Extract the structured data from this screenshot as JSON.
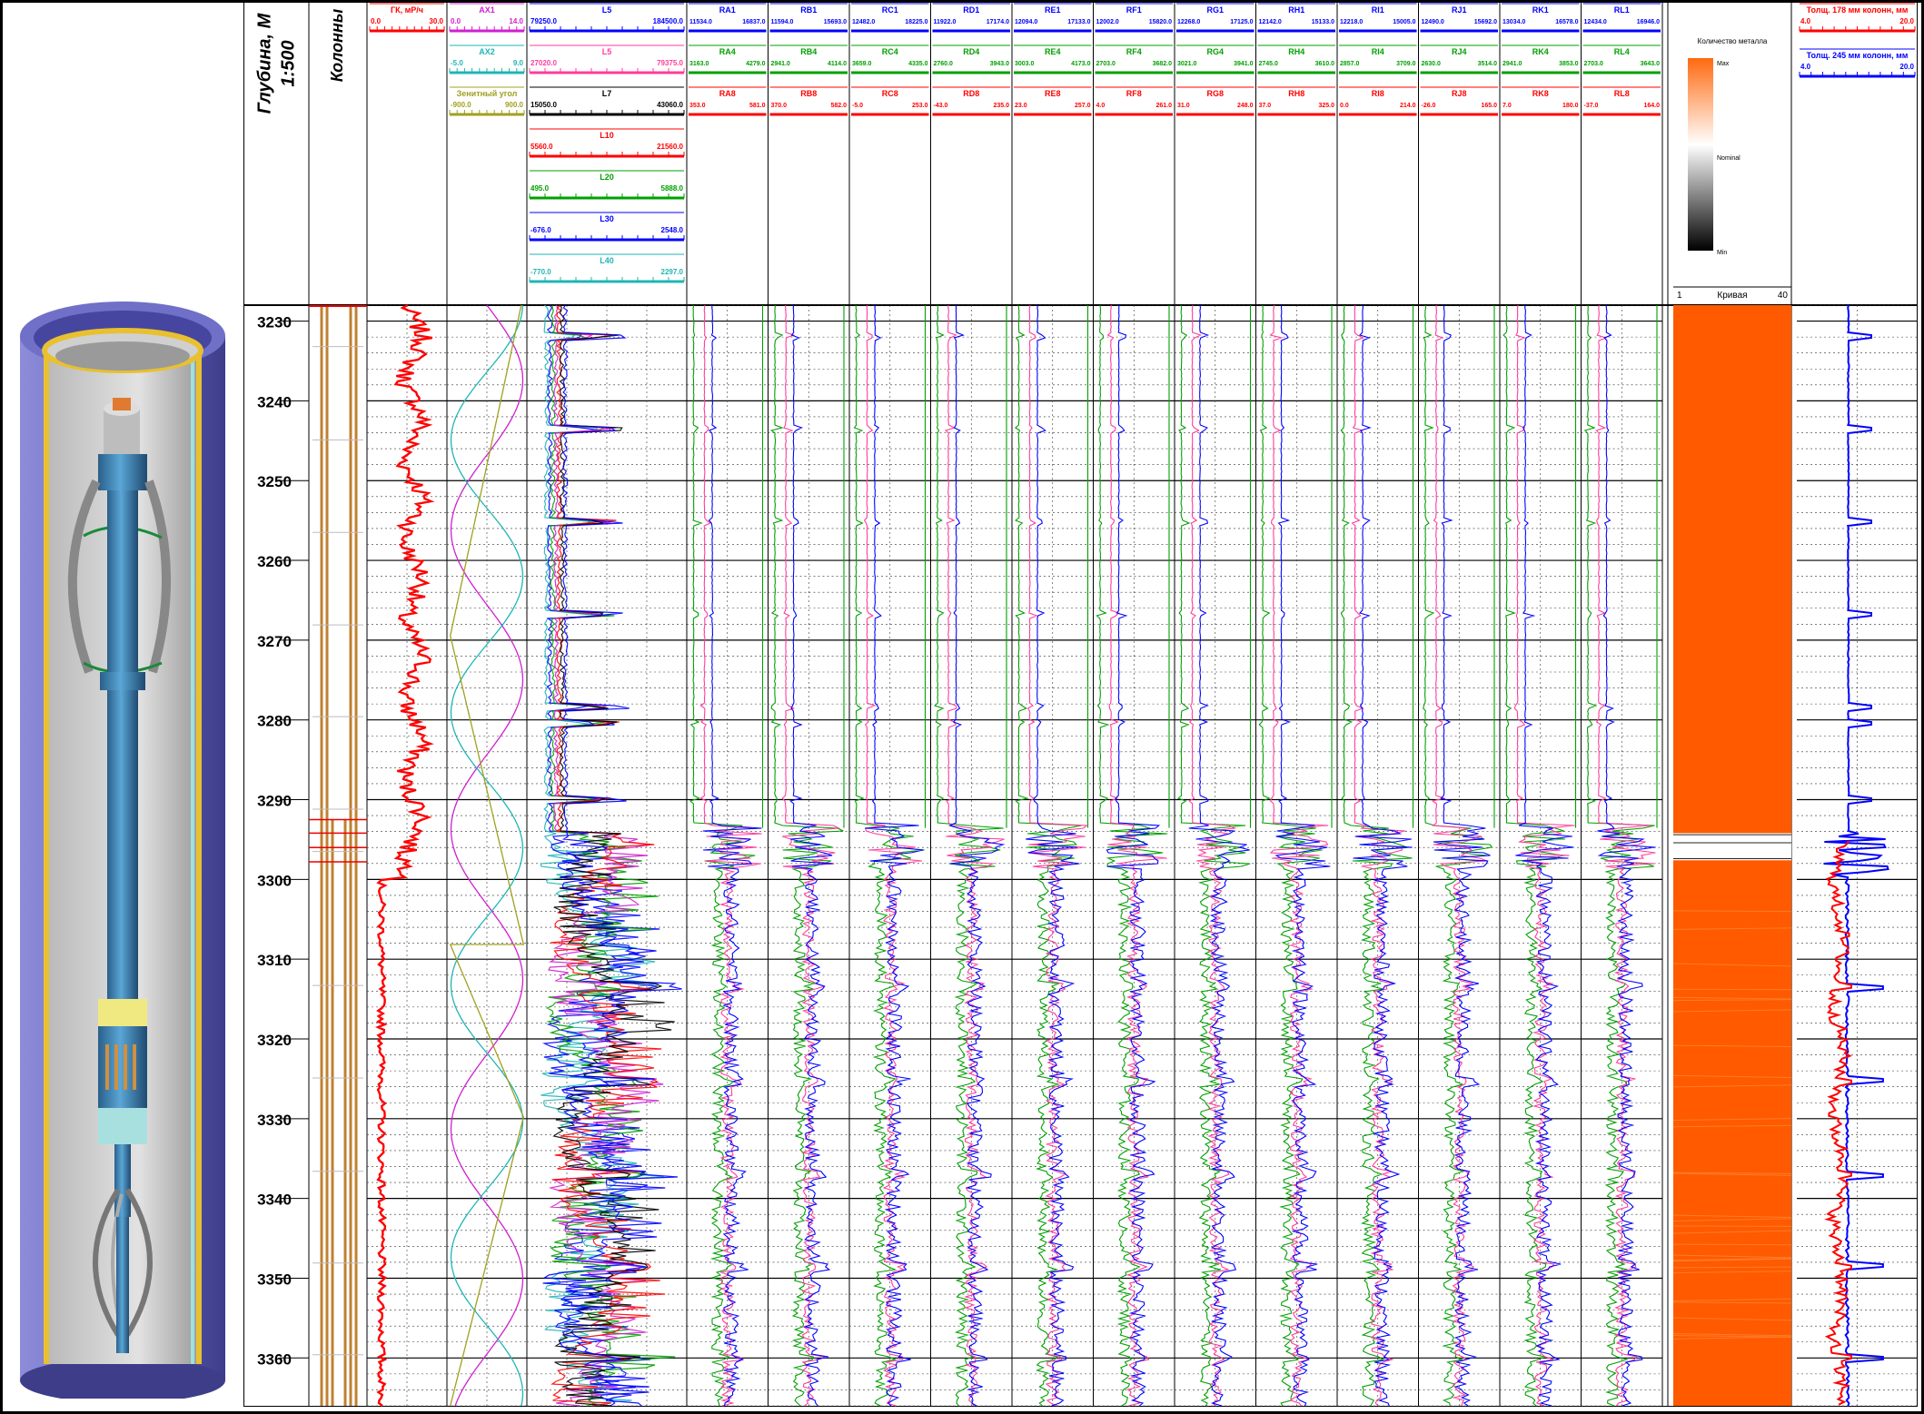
{
  "header": {
    "depth_title": "Глубина, М",
    "scale": "1:500",
    "columns_title": "Колонны"
  },
  "colors": {
    "red": "#ff0000",
    "pink": "#ff3c9b",
    "green": "#00a000",
    "blue": "#0000ff",
    "teal": "#1fb5b5",
    "olive": "#a0a020",
    "magenta": "#d020d0",
    "black": "#000000",
    "orange": "#ff5a00",
    "casing": "#c08030"
  },
  "tracks": {
    "gk": {
      "name": "ГК, мР/ч",
      "min": "0.0",
      "max": "30.0",
      "color": "red"
    },
    "angles": [
      {
        "name": "AX1",
        "min": "0.0",
        "max": "14.0",
        "color": "magenta"
      },
      {
        "name": "AX2",
        "min": "-5.0",
        "max": "9.0",
        "color": "teal"
      },
      {
        "name": "Зенитный угол",
        "min": "-900.0",
        "max": "900.0",
        "color": "olive"
      }
    ],
    "long": [
      {
        "name": "L5",
        "min": "79250.0",
        "max": "184500.0",
        "color": "blue"
      },
      {
        "name": "L5",
        "min": "27020.0",
        "max": "79375.0",
        "color": "pink"
      },
      {
        "name": "L7",
        "min": "15050.0",
        "max": "43060.0",
        "color": "black"
      },
      {
        "name": "L10",
        "min": "5560.0",
        "max": "21560.0",
        "color": "red"
      },
      {
        "name": "L20",
        "min": "495.0",
        "max": "5888.0",
        "color": "green"
      },
      {
        "name": "L30",
        "min": "-676.0",
        "max": "2548.0",
        "color": "blue"
      },
      {
        "name": "L40",
        "min": "-770.0",
        "max": "2297.0",
        "color": "teal"
      }
    ],
    "sensors": [
      {
        "h": [
          [
            "RA1",
            "11534.0",
            "16837.0"
          ],
          [
            "RA4",
            "3163.0",
            "4279.0"
          ],
          [
            "RA8",
            "353.0",
            "581.0"
          ]
        ]
      },
      {
        "h": [
          [
            "RB1",
            "11594.0",
            "15693.0"
          ],
          [
            "RB4",
            "2941.0",
            "4114.0"
          ],
          [
            "RB8",
            "370.0",
            "582.0"
          ]
        ]
      },
      {
        "h": [
          [
            "RC1",
            "12482.0",
            "18225.0"
          ],
          [
            "RC4",
            "3659.0",
            "4335.0"
          ],
          [
            "RC8",
            "-5.0",
            "253.0"
          ]
        ]
      },
      {
        "h": [
          [
            "RD1",
            "11922.0",
            "17174.0"
          ],
          [
            "RD4",
            "2760.0",
            "3943.0"
          ],
          [
            "RD8",
            "-43.0",
            "235.0"
          ]
        ]
      },
      {
        "h": [
          [
            "RE1",
            "12094.0",
            "17133.0"
          ],
          [
            "RE4",
            "3003.0",
            "4173.0"
          ],
          [
            "RE8",
            "23.0",
            "257.0"
          ]
        ]
      },
      {
        "h": [
          [
            "RF1",
            "12002.0",
            "15820.0"
          ],
          [
            "RF4",
            "2703.0",
            "3682.0"
          ],
          [
            "RF8",
            "4.0",
            "261.0"
          ]
        ]
      },
      {
        "h": [
          [
            "RG1",
            "12268.0",
            "17125.0"
          ],
          [
            "RG4",
            "3021.0",
            "3941.0"
          ],
          [
            "RG8",
            "31.0",
            "248.0"
          ]
        ]
      },
      {
        "h": [
          [
            "RH1",
            "12142.0",
            "15133.0"
          ],
          [
            "RH4",
            "2745.0",
            "3610.0"
          ],
          [
            "RH8",
            "37.0",
            "325.0"
          ]
        ]
      },
      {
        "h": [
          [
            "RI1",
            "12218.0",
            "15005.0"
          ],
          [
            "RI4",
            "2857.0",
            "3709.0"
          ],
          [
            "RI8",
            "0.0",
            "214.0"
          ]
        ]
      },
      {
        "h": [
          [
            "RJ1",
            "12490.0",
            "15692.0"
          ],
          [
            "RJ4",
            "2630.0",
            "3514.0"
          ],
          [
            "RJ8",
            "-26.0",
            "165.0"
          ]
        ]
      },
      {
        "h": [
          [
            "RK1",
            "13034.0",
            "16578.0"
          ],
          [
            "RK4",
            "2941.0",
            "3853.0"
          ],
          [
            "RK8",
            "7.0",
            "180.0"
          ]
        ]
      },
      {
        "h": [
          [
            "RL1",
            "12434.0",
            "16946.0"
          ],
          [
            "RL4",
            "2703.0",
            "3643.0"
          ],
          [
            "RL8",
            "-37.0",
            "164.0"
          ]
        ]
      }
    ],
    "metal": {
      "name": "Количество металла",
      "max": "Max",
      "nominal": "Nominal",
      "min": "Min",
      "curve_left": "1",
      "curve": "Кривая",
      "curve_right": "40"
    },
    "thickness": [
      {
        "name": "Толщ. 178 мм колонн, мм",
        "min": "4.0",
        "max": "20.0",
        "color": "red"
      },
      {
        "name": "Толщ. 245 мм колонн, мм",
        "min": "4.0",
        "max": "20.0",
        "color": "blue"
      }
    ]
  },
  "chart_data": {
    "type": "line",
    "title": "",
    "depth_axis": {
      "label": "Глубина, М",
      "min": 3228,
      "max": 3366,
      "ticks": [
        3230,
        3240,
        3250,
        3260,
        3270,
        3280,
        3290,
        3300,
        3310,
        3320,
        3330,
        3340,
        3350,
        3360
      ]
    },
    "casing_joints_depth": [
      3233.2,
      3244.9,
      3256.5,
      3268.1,
      3279.6,
      3291.2,
      3296.5,
      3313.3,
      3324.9,
      3336.6,
      3348.1,
      3359.6
    ],
    "collar_178_depth": [
      3232.0,
      3243.5,
      3255.3,
      3266.9,
      3278.4,
      3280.3,
      3289.9
    ],
    "collar_245_depth": [
      3313.5,
      3325.3,
      3337.0,
      3348.5,
      3360.0
    ],
    "casing_shoe_depth": 3294.5,
    "series": [
      {
        "name": "ГК, мР/ч",
        "track": "gk",
        "range": [
          0,
          30
        ],
        "description_values": "noisy 13-30 above 3290, 1-9 below 3300"
      },
      {
        "name": "AX1",
        "range": [
          0,
          14
        ],
        "shape": "sinusoid"
      },
      {
        "name": "AX2",
        "range": [
          -5,
          9
        ],
        "shape": "sinusoid"
      },
      {
        "name": "Зенитный угол",
        "range": [
          -900,
          900
        ],
        "shape": "sawtooth"
      }
    ]
  }
}
